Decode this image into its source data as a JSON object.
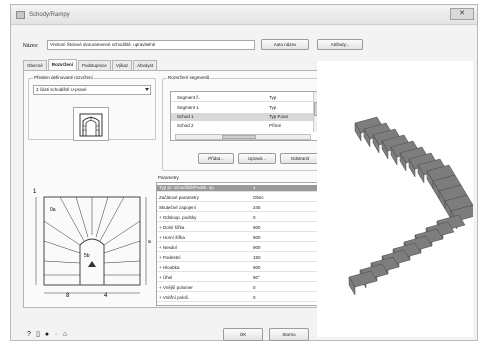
{
  "window": {
    "title": "Schody/Rampy",
    "close_glyph": "✕"
  },
  "header": {
    "name_label": "Název:",
    "name_value": "Vnitroní Štolové dvouramenné schodiště, upravitelné",
    "auto_button": "Auto název",
    "attributes_button": "Atributy..."
  },
  "tabs": [
    {
      "label": "Obecné",
      "active": false
    },
    {
      "label": "Rozvržení",
      "active": true
    },
    {
      "label": "Podstupnice",
      "active": false
    },
    {
      "label": "Výkaz",
      "active": false
    },
    {
      "label": "Abvdyst",
      "active": false
    }
  ],
  "shape_group": {
    "label": "Předem definované rozvržení",
    "combo_value": "3 části schodiště U-pravé"
  },
  "segments_group": {
    "label": "Rozvržení segmentů",
    "columns": [
      "Segment č.",
      "Typ"
    ],
    "rows": [
      {
        "name": "Segment 1",
        "type": "Typ",
        "selected": false
      },
      {
        "name": "Schod 1",
        "type": "Typ P.avs",
        "selected": true
      },
      {
        "name": "Schod 2",
        "type": "Přímé",
        "selected": false
      }
    ],
    "add_button": "Přidat...",
    "edit_button": "Upravit...",
    "remove_button": "Odstranit"
  },
  "properties": {
    "label": "Parametry",
    "rows": [
      {
        "name": "Typ pr. schodiště/Podsk. sp.",
        "value": "1",
        "selected": true
      },
      {
        "name": "Začátové parametry",
        "value": "Obec",
        "selected": false
      },
      {
        "name": "Skutečné zapojení",
        "value": "245",
        "selected": false
      },
      {
        "name": "+  Odsloup. podsky",
        "value": "0",
        "selected": false
      },
      {
        "name": "+  Dolní šířka",
        "value": "900",
        "selected": false
      },
      {
        "name": "+  Horní šířka",
        "value": "900",
        "selected": false
      },
      {
        "name": "+  Nesání",
        "value": "900",
        "selected": false
      },
      {
        "name": "+  Podestní",
        "value": "150",
        "selected": false
      },
      {
        "name": "+  Hloubka",
        "value": "900",
        "selected": false
      },
      {
        "name": "+  Úhel",
        "value": "90°",
        "selected": false
      },
      {
        "name": "+  Vnější polomer",
        "value": "0",
        "selected": false
      },
      {
        "name": "+  Vnitřní pološ.",
        "value": "0",
        "selected": false
      }
    ]
  },
  "plan": {
    "dim_a": "1",
    "dim_b": "0a",
    "dim_c": "8",
    "dim_d": "5b",
    "dim_e": "4",
    "dim_f": "a"
  },
  "footer": {
    "icons": [
      "help-icon",
      "info-icon",
      "library-icon",
      "arrow-icon",
      "tool-icon"
    ],
    "ok_button": "OK",
    "cancel_button": "Storno"
  },
  "colors": {
    "stair_fill": "#7d7d7d",
    "stair_edge": "#4a4a4a",
    "selection": "#9a9a9a"
  }
}
